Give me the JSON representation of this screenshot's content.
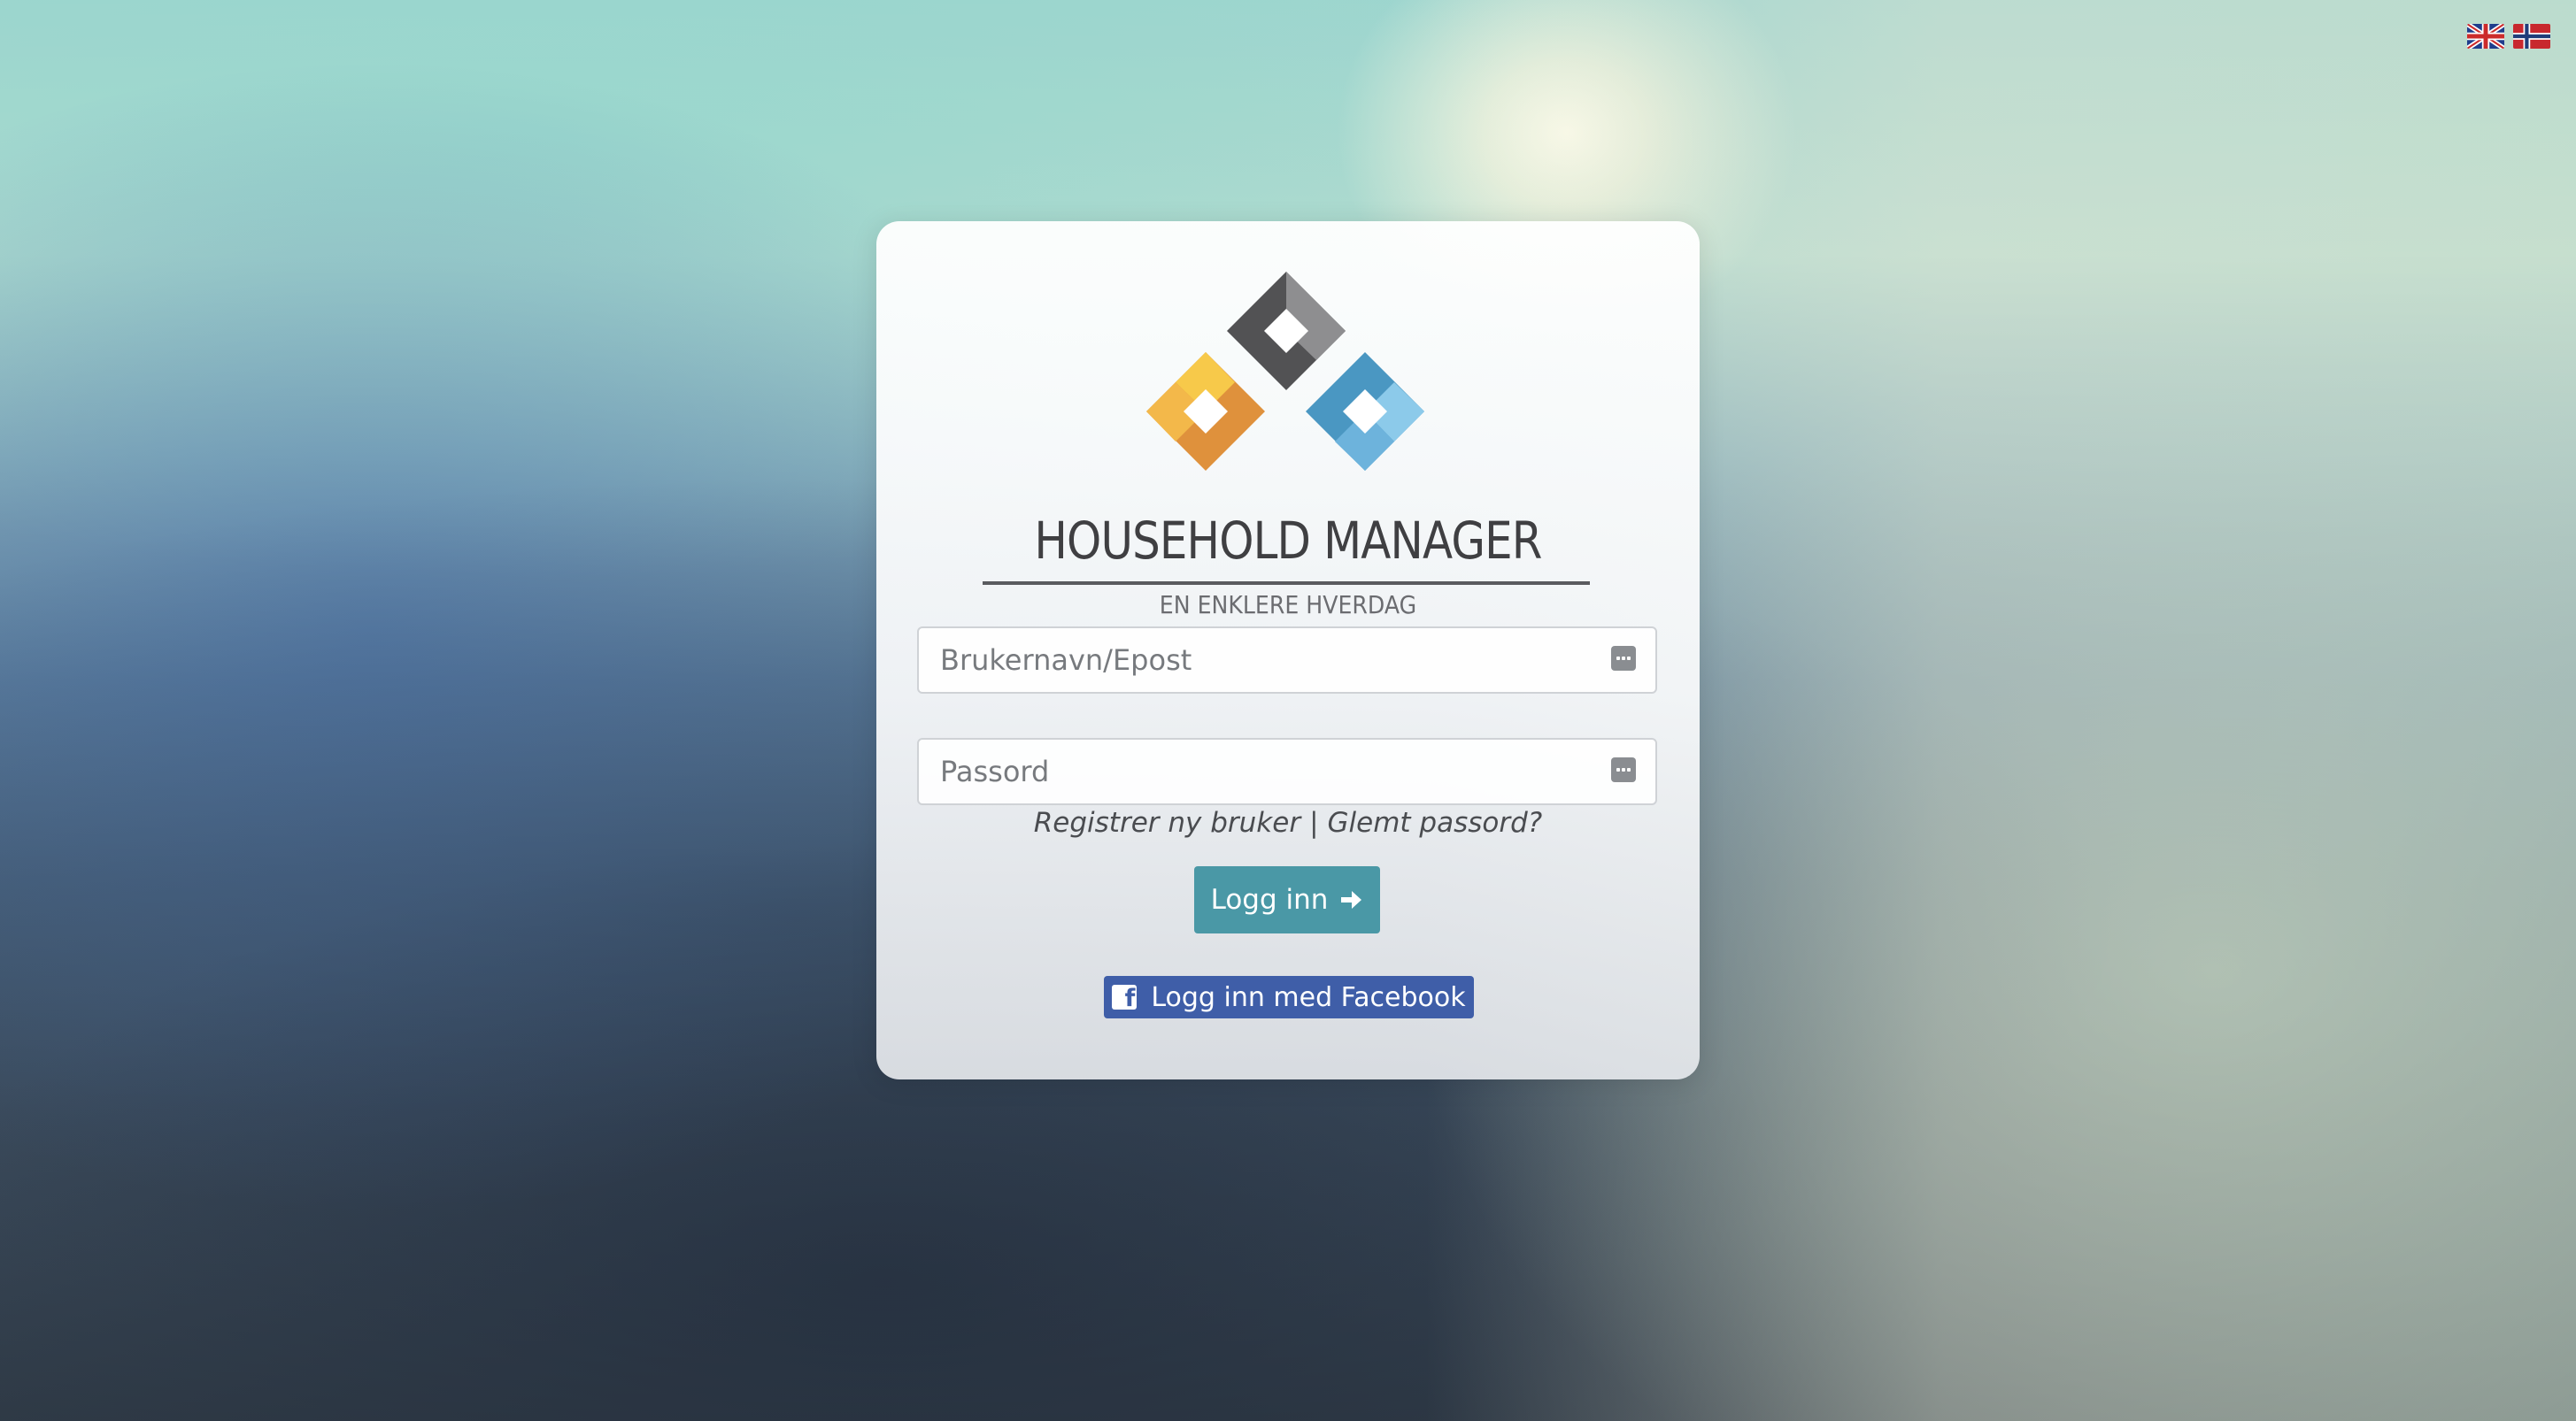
{
  "language_flags": [
    {
      "name": "english-flag-icon"
    },
    {
      "name": "norwegian-flag-icon"
    }
  ],
  "logo": {
    "title": "HOUSEHOLD MANAGER",
    "subtitle": "EN ENKLERE HVERDAG",
    "colors": {
      "dark": "#4f4f52",
      "gray": "#8d8d8f",
      "orange": "#e1953f",
      "yellow": "#f7c94a",
      "blue": "#4f9cc7",
      "light_blue": "#8cc7ea"
    }
  },
  "login_form": {
    "username_placeholder": "Brukernavn/Epost",
    "password_placeholder": "Passord",
    "register_link": "Registrer ny bruker",
    "separator": "|",
    "forgot_link": "Glemt passord?",
    "login_button": "Logg inn",
    "facebook_button": "Logg inn med Facebook"
  },
  "colors": {
    "login_button": "#4a98a6",
    "facebook_button": "#3f5ea8"
  }
}
